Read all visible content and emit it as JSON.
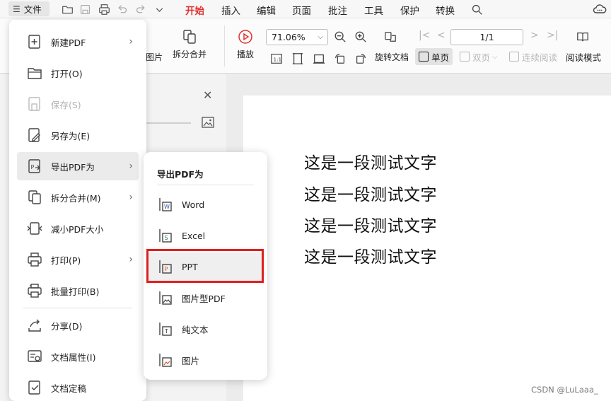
{
  "menubar": {
    "file_label": "文件",
    "tabs": [
      {
        "label": "开始",
        "active": true
      },
      {
        "label": "插入"
      },
      {
        "label": "编辑"
      },
      {
        "label": "页面"
      },
      {
        "label": "批注"
      },
      {
        "label": "工具"
      },
      {
        "label": "保护"
      },
      {
        "label": "转换"
      }
    ],
    "accent_color": "#e0302c"
  },
  "ribbon": {
    "image_label": "图片",
    "split_merge_label": "拆分合并",
    "play_label": "播放",
    "zoom_value": "71.06%",
    "page_value": "1/1",
    "rotate_label": "旋转文档",
    "single_page_label": "单页",
    "double_page_label": "双页",
    "continuous_label": "连续阅读",
    "reading_mode_label": "阅读模式"
  },
  "file_menu": {
    "items": [
      {
        "label": "新建PDF",
        "icon": "new-pdf-icon",
        "submenu": true
      },
      {
        "label": "打开(O)",
        "icon": "folder-open-icon"
      },
      {
        "label": "保存(S)",
        "icon": "save-icon",
        "disabled": true
      },
      {
        "label": "另存为(E)",
        "icon": "save-as-icon"
      },
      {
        "label": "导出PDF为",
        "icon": "export-pdf-icon",
        "submenu": true,
        "highlighted": true
      },
      {
        "label": "拆分合并(M)",
        "icon": "split-merge-icon",
        "submenu": true
      },
      {
        "label": "减小PDF大小",
        "icon": "compress-icon"
      },
      {
        "label": "打印(P)",
        "icon": "print-icon",
        "submenu": true
      },
      {
        "label": "批量打印(B)",
        "icon": "batch-print-icon"
      },
      {
        "label": "分享(D)",
        "icon": "share-icon"
      },
      {
        "label": "文档属性(I)",
        "icon": "properties-icon"
      },
      {
        "label": "文档定稿",
        "icon": "finalize-icon"
      }
    ]
  },
  "export_submenu": {
    "title": "导出PDF为",
    "items": [
      {
        "label": "Word",
        "icon": "word-file-icon"
      },
      {
        "label": "Excel",
        "icon": "excel-file-icon"
      },
      {
        "label": "PPT",
        "icon": "ppt-file-icon",
        "highlighted": true
      },
      {
        "label": "图片型PDF",
        "icon": "image-pdf-icon"
      },
      {
        "label": "纯文本",
        "icon": "text-file-icon"
      },
      {
        "label": "图片",
        "icon": "image-file-icon"
      }
    ],
    "highlight_color": "#e01f1f"
  },
  "document": {
    "lines": [
      "这是一段测试文字",
      "这是一段测试文字",
      "这是一段测试文字",
      "这是一段测试文字"
    ]
  },
  "watermark": "CSDN @LuLaaa_"
}
